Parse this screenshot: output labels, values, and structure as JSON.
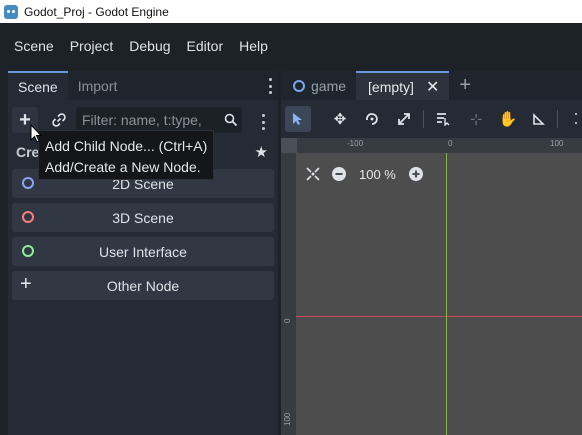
{
  "window": {
    "title": "Godot_Proj - Godot Engine"
  },
  "menu": [
    "Scene",
    "Project",
    "Debug",
    "Editor",
    "Help"
  ],
  "dock": {
    "tabs": [
      "Scene",
      "Import"
    ],
    "filter_placeholder": "Filter: name, t:type,",
    "create_label": "Cre",
    "nodes": [
      {
        "label": "2D Scene",
        "color": "#8da5f3"
      },
      {
        "label": "3D Scene",
        "color": "#fc7f7f"
      },
      {
        "label": "User Interface",
        "color": "#8eef97"
      },
      {
        "label": "Other Node",
        "icon": "plus-icon"
      }
    ]
  },
  "tooltip": {
    "line1": "Add Child Node... (Ctrl+A)",
    "line2": "Add/Create a New Node."
  },
  "editor": {
    "tabs": [
      {
        "label": "game"
      },
      {
        "label": "[empty]"
      }
    ],
    "zoom": "100 %",
    "ruler_top": [
      "-100",
      "0",
      "100"
    ],
    "ruler_left": [
      "0",
      "100"
    ]
  }
}
